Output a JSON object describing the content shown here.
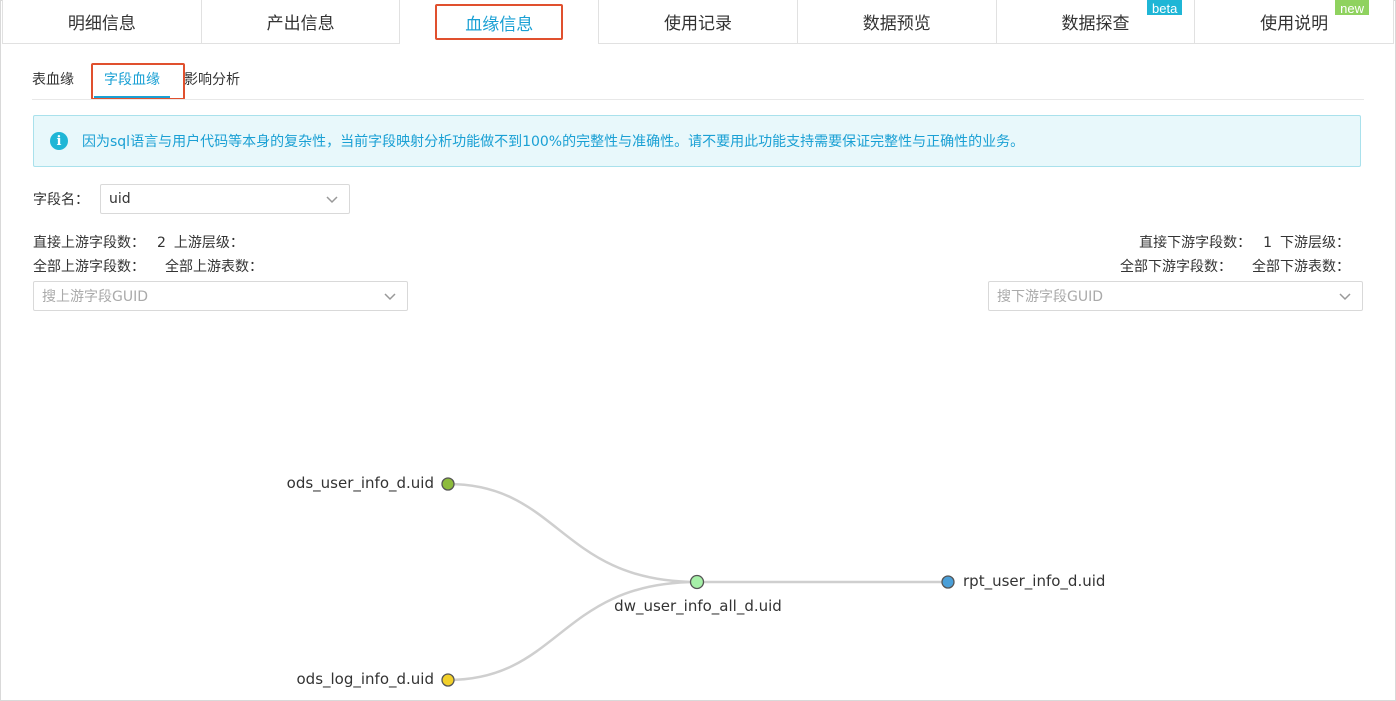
{
  "main_tabs": [
    {
      "label": "明细信息"
    },
    {
      "label": "产出信息"
    },
    {
      "label": "血缘信息"
    },
    {
      "label": "使用记录"
    },
    {
      "label": "数据预览"
    },
    {
      "label": "数据探查",
      "badge": "beta"
    },
    {
      "label": "使用说明",
      "badge": "new"
    }
  ],
  "sub_tabs": [
    {
      "label": "表血缘"
    },
    {
      "label": "字段血缘"
    },
    {
      "label": "影响分析"
    }
  ],
  "notice": {
    "text": "因为sql语言与用户代码等本身的复杂性，当前字段映射分析功能做不到100%的完整性与准确性。请不要用此功能支持需要保证完整性与正确性的业务。"
  },
  "field": {
    "label": "字段名：",
    "value": "uid"
  },
  "upstream": {
    "direct_label": "直接上游字段数：",
    "direct_value": "2",
    "level_label": "上游层级：",
    "all_fields_label": "全部上游字段数：",
    "all_tables_label": "全部上游表数：",
    "search_placeholder": "搜上游字段GUID"
  },
  "downstream": {
    "direct_label": "直接下游字段数：",
    "direct_value": "1",
    "level_label": "下游层级：",
    "all_fields_label": "全部下游字段数：",
    "all_tables_label": "全部下游表数：",
    "search_placeholder": "搜下游字段GUID"
  },
  "graph": {
    "nodes": [
      {
        "id": "ods_user",
        "label": "ods_user_info_d.uid",
        "color": "#8dbb3c"
      },
      {
        "id": "ods_log",
        "label": "ods_log_info_d.uid",
        "color": "#f2d02a"
      },
      {
        "id": "dw",
        "label": "dw_user_info_all_d.uid",
        "color": "#a6f0a8"
      },
      {
        "id": "rpt",
        "label": "rpt_user_info_d.uid",
        "color": "#4a9fd8"
      }
    ]
  },
  "colors": {
    "accent": "#1aa0d4",
    "highlight": "#e0502e",
    "edge": "#cfcfcf"
  }
}
